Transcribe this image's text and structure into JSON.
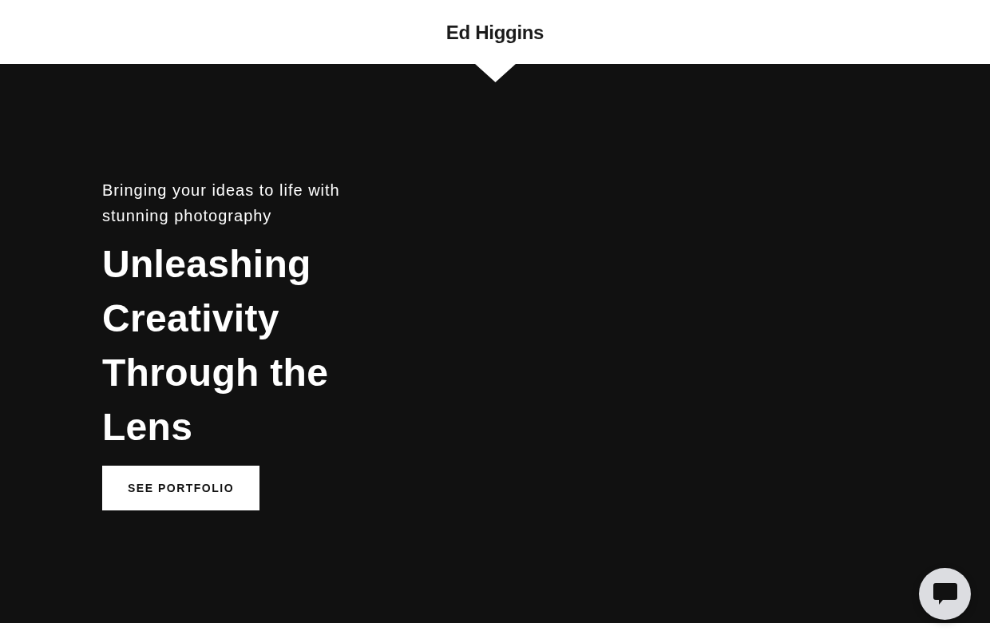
{
  "header": {
    "title": "Ed Higgins"
  },
  "hero": {
    "tagline": "Bringing your ideas to life with stunning photography",
    "heading": "Unleashing Creativity Through the Lens",
    "button": "SEE PORTFOLIO"
  }
}
